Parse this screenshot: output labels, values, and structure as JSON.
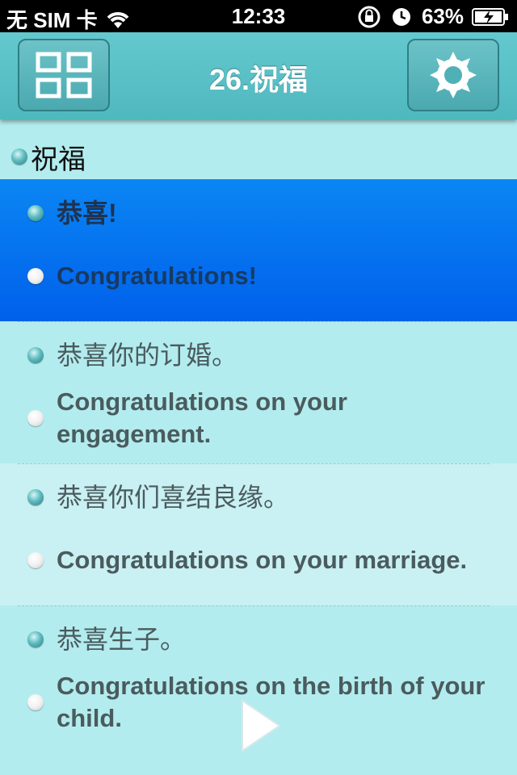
{
  "status_bar": {
    "carrier": "无 SIM 卡",
    "time": "12:33",
    "battery": "63%",
    "icons": [
      "wifi-icon",
      "rotation-lock-icon",
      "alarm-icon",
      "battery-icon"
    ]
  },
  "navbar": {
    "title": "26.祝福",
    "left_icon": "grid-menu-icon",
    "right_icon": "settings-gear-icon"
  },
  "section": {
    "label": "祝福"
  },
  "entries": [
    {
      "chinese": "恭喜!",
      "english": "Congratulations!",
      "active": true
    },
    {
      "chinese": "恭喜你的订婚。",
      "english": "Congratulations on your engagement."
    },
    {
      "chinese": "恭喜你们喜结良缘。",
      "english": "Congratulations on your marriage."
    },
    {
      "chinese": "恭喜生子。",
      "english": "Congratulations on the birth of your child."
    }
  ],
  "colors": {
    "background": "#b3ecee",
    "navbar": "#56bfc5",
    "active_row": "#0a7cf2",
    "text": "#4a5b5e"
  }
}
